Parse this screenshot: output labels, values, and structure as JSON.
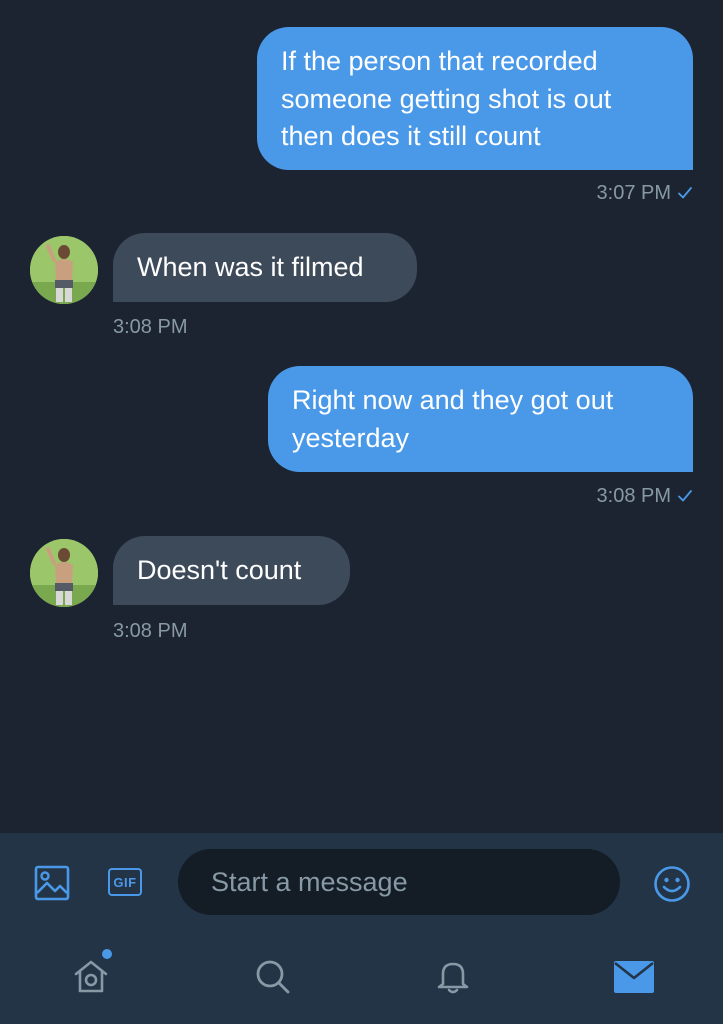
{
  "colors": {
    "background": "#1c2431",
    "outgoing_bubble": "#4a99e9",
    "incoming_bubble": "#3d4a5a",
    "timestamp": "#8899a6",
    "accent": "#4a99e9",
    "bar": "#243447",
    "input_bg": "#141d26"
  },
  "messages": [
    {
      "direction": "outgoing",
      "lines": [
        "If the person that recorded",
        "someone getting shot is out",
        "then does it still count"
      ],
      "time": "3:07 PM",
      "read": true
    },
    {
      "direction": "incoming",
      "lines": [
        "When was it filmed"
      ],
      "time": "3:08 PM"
    },
    {
      "direction": "outgoing",
      "lines": [
        "Right now and they got out",
        "yesterday"
      ],
      "time": "3:08 PM",
      "read": true
    },
    {
      "direction": "incoming",
      "lines": [
        "Doesn't count"
      ],
      "time": "3:08 PM"
    }
  ],
  "composer": {
    "media_icon": "image-icon",
    "gif_label": "GIF",
    "placeholder": "Start a message",
    "emoji_icon": "emoji-icon"
  },
  "tabbar": {
    "items": [
      {
        "icon": "home-icon",
        "has_notification_dot": true,
        "active": false
      },
      {
        "icon": "search-icon",
        "active": false
      },
      {
        "icon": "bell-icon",
        "active": false
      },
      {
        "icon": "mail-icon",
        "active": true
      }
    ]
  }
}
